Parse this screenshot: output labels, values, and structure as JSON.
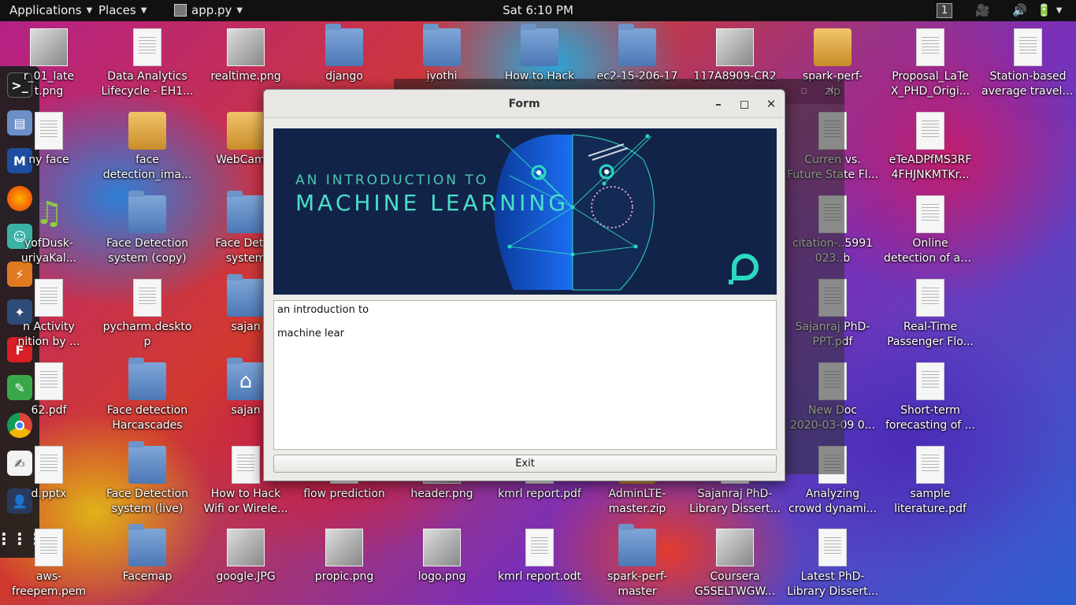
{
  "topbar": {
    "applications": "Applications",
    "places": "Places",
    "app": "app.py",
    "clock": "Sat  6:10 PM",
    "workspace": "1"
  },
  "window": {
    "title": "Form",
    "banner_line1": "AN INTRODUCTION TO",
    "banner_line2": "MACHINE LEARNING",
    "text_lines": [
      "an introduction to",
      "machine lear"
    ],
    "exit_label": "Exit"
  },
  "dock": {
    "icons": [
      "terminal-icon",
      "files-icon",
      "metasploit-icon",
      "firefox-icon",
      "avatar-app-icon",
      "burpsuite-icon",
      "app-icon",
      "flashfxp-icon",
      "leafpad-icon",
      "chrome-icon",
      "text-editor-icon",
      "user-photo-icon",
      "show-apps-icon"
    ]
  },
  "desktop": {
    "icons": [
      {
        "label": "r_01_late\nt.png",
        "type": "image"
      },
      {
        "label": "Data Analytics\nLifecycle - EH1...",
        "type": "doc"
      },
      {
        "label": "realtime.png",
        "type": "image"
      },
      {
        "label": "django",
        "type": "folder"
      },
      {
        "label": "jyothi",
        "type": "folder"
      },
      {
        "label": "How to Hack",
        "type": "folder"
      },
      {
        "label": "ec2-15-206-17",
        "type": "folder"
      },
      {
        "label": "117A8909-CR2",
        "type": "image"
      },
      {
        "label": "spark-perf-\nzip",
        "type": "archive"
      },
      {
        "label": "Proposal_LaTe\nX_PHD_Origi...",
        "type": "doc"
      },
      {
        "label": "Station-based\naverage travel ...",
        "type": "doc"
      },
      {
        "label": "ny face",
        "type": "doc"
      },
      {
        "label": "face\ndetection_ima...",
        "type": "archive"
      },
      {
        "label": "WebCam...",
        "type": "archive"
      },
      {
        "label": "Curren vs.\nFuture State Fl...",
        "type": "doc"
      },
      {
        "label": "eTeADPfMS3RF\n4FHJNKMTKr...",
        "type": "doc"
      },
      {
        "label": "yofDusk-\nuriyaKal...",
        "type": "music"
      },
      {
        "label": "Face Detection\nsystem (copy)",
        "type": "folder"
      },
      {
        "label": "Face Detec\nsystem",
        "type": "folder"
      },
      {
        "label": "citation-..5991\n023..b",
        "type": "doc"
      },
      {
        "label": "Online\ndetection of ab...",
        "type": "doc"
      },
      {
        "label": "n Activity\nnition by ...",
        "type": "doc"
      },
      {
        "label": "pycharm.deskto\np",
        "type": "doc"
      },
      {
        "label": "sajan",
        "type": "folder"
      },
      {
        "label": "Sajanraj PhD-\nPPT.pdf",
        "type": "doc"
      },
      {
        "label": "Real-Time\nPassenger Flo...",
        "type": "doc"
      },
      {
        "label": "62.pdf",
        "type": "doc"
      },
      {
        "label": "Face detection\nHarcascades",
        "type": "folder"
      },
      {
        "label": "sajan",
        "type": "home"
      },
      {
        "label": "New Doc\n2020-03-09 0...",
        "type": "doc"
      },
      {
        "label": "Short-term\nforecasting of ...",
        "type": "doc"
      },
      {
        "label": "d.pptx",
        "type": "doc"
      },
      {
        "label": "Face Detection\nsystem (live)",
        "type": "folder"
      },
      {
        "label": "How to Hack\nWifi or Wirele...",
        "type": "doc"
      },
      {
        "label": "flow prediction",
        "type": "doc"
      },
      {
        "label": "header.png",
        "type": "image"
      },
      {
        "label": "kmrl report.pdf",
        "type": "doc"
      },
      {
        "label": "AdminLTE-\nmaster.zip",
        "type": "archive"
      },
      {
        "label": "Sajanraj PhD-\nLibrary Dissert...",
        "type": "doc"
      },
      {
        "label": "Analyzing\ncrowd dynami...",
        "type": "doc"
      },
      {
        "label": "sample\nliterature.pdf",
        "type": "doc"
      },
      {
        "label": "aws-\nfreepem.pem",
        "type": "doc"
      },
      {
        "label": "Facemap",
        "type": "folder"
      },
      {
        "label": "google.JPG",
        "type": "image"
      },
      {
        "label": "propic.png",
        "type": "image"
      },
      {
        "label": "logo.png",
        "type": "image"
      },
      {
        "label": "kmrl report.odt",
        "type": "doc"
      },
      {
        "label": "spark-perf-\nmaster",
        "type": "folder"
      },
      {
        "label": "Coursera\nG5SELTWGW...",
        "type": "image"
      },
      {
        "label": "Latest PhD-\nLibrary Dissert...",
        "type": "doc"
      }
    ]
  }
}
